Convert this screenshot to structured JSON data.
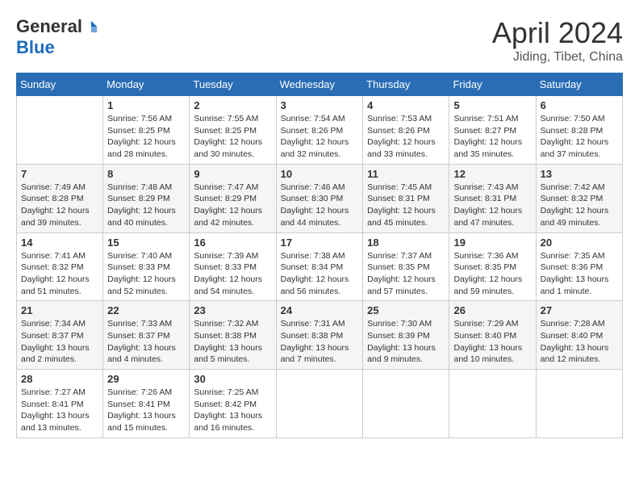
{
  "logo": {
    "general": "General",
    "blue": "Blue"
  },
  "title": "April 2024",
  "location": "Jiding, Tibet, China",
  "days_of_week": [
    "Sunday",
    "Monday",
    "Tuesday",
    "Wednesday",
    "Thursday",
    "Friday",
    "Saturday"
  ],
  "weeks": [
    [
      {
        "day": "",
        "info": ""
      },
      {
        "day": "1",
        "info": "Sunrise: 7:56 AM\nSunset: 8:25 PM\nDaylight: 12 hours and 28 minutes."
      },
      {
        "day": "2",
        "info": "Sunrise: 7:55 AM\nSunset: 8:25 PM\nDaylight: 12 hours and 30 minutes."
      },
      {
        "day": "3",
        "info": "Sunrise: 7:54 AM\nSunset: 8:26 PM\nDaylight: 12 hours and 32 minutes."
      },
      {
        "day": "4",
        "info": "Sunrise: 7:53 AM\nSunset: 8:26 PM\nDaylight: 12 hours and 33 minutes."
      },
      {
        "day": "5",
        "info": "Sunrise: 7:51 AM\nSunset: 8:27 PM\nDaylight: 12 hours and 35 minutes."
      },
      {
        "day": "6",
        "info": "Sunrise: 7:50 AM\nSunset: 8:28 PM\nDaylight: 12 hours and 37 minutes."
      }
    ],
    [
      {
        "day": "7",
        "info": "Sunrise: 7:49 AM\nSunset: 8:28 PM\nDaylight: 12 hours and 39 minutes."
      },
      {
        "day": "8",
        "info": "Sunrise: 7:48 AM\nSunset: 8:29 PM\nDaylight: 12 hours and 40 minutes."
      },
      {
        "day": "9",
        "info": "Sunrise: 7:47 AM\nSunset: 8:29 PM\nDaylight: 12 hours and 42 minutes."
      },
      {
        "day": "10",
        "info": "Sunrise: 7:46 AM\nSunset: 8:30 PM\nDaylight: 12 hours and 44 minutes."
      },
      {
        "day": "11",
        "info": "Sunrise: 7:45 AM\nSunset: 8:31 PM\nDaylight: 12 hours and 45 minutes."
      },
      {
        "day": "12",
        "info": "Sunrise: 7:43 AM\nSunset: 8:31 PM\nDaylight: 12 hours and 47 minutes."
      },
      {
        "day": "13",
        "info": "Sunrise: 7:42 AM\nSunset: 8:32 PM\nDaylight: 12 hours and 49 minutes."
      }
    ],
    [
      {
        "day": "14",
        "info": "Sunrise: 7:41 AM\nSunset: 8:32 PM\nDaylight: 12 hours and 51 minutes."
      },
      {
        "day": "15",
        "info": "Sunrise: 7:40 AM\nSunset: 8:33 PM\nDaylight: 12 hours and 52 minutes."
      },
      {
        "day": "16",
        "info": "Sunrise: 7:39 AM\nSunset: 8:33 PM\nDaylight: 12 hours and 54 minutes."
      },
      {
        "day": "17",
        "info": "Sunrise: 7:38 AM\nSunset: 8:34 PM\nDaylight: 12 hours and 56 minutes."
      },
      {
        "day": "18",
        "info": "Sunrise: 7:37 AM\nSunset: 8:35 PM\nDaylight: 12 hours and 57 minutes."
      },
      {
        "day": "19",
        "info": "Sunrise: 7:36 AM\nSunset: 8:35 PM\nDaylight: 12 hours and 59 minutes."
      },
      {
        "day": "20",
        "info": "Sunrise: 7:35 AM\nSunset: 8:36 PM\nDaylight: 13 hours and 1 minute."
      }
    ],
    [
      {
        "day": "21",
        "info": "Sunrise: 7:34 AM\nSunset: 8:37 PM\nDaylight: 13 hours and 2 minutes."
      },
      {
        "day": "22",
        "info": "Sunrise: 7:33 AM\nSunset: 8:37 PM\nDaylight: 13 hours and 4 minutes."
      },
      {
        "day": "23",
        "info": "Sunrise: 7:32 AM\nSunset: 8:38 PM\nDaylight: 13 hours and 5 minutes."
      },
      {
        "day": "24",
        "info": "Sunrise: 7:31 AM\nSunset: 8:38 PM\nDaylight: 13 hours and 7 minutes."
      },
      {
        "day": "25",
        "info": "Sunrise: 7:30 AM\nSunset: 8:39 PM\nDaylight: 13 hours and 9 minutes."
      },
      {
        "day": "26",
        "info": "Sunrise: 7:29 AM\nSunset: 8:40 PM\nDaylight: 13 hours and 10 minutes."
      },
      {
        "day": "27",
        "info": "Sunrise: 7:28 AM\nSunset: 8:40 PM\nDaylight: 13 hours and 12 minutes."
      }
    ],
    [
      {
        "day": "28",
        "info": "Sunrise: 7:27 AM\nSunset: 8:41 PM\nDaylight: 13 hours and 13 minutes."
      },
      {
        "day": "29",
        "info": "Sunrise: 7:26 AM\nSunset: 8:41 PM\nDaylight: 13 hours and 15 minutes."
      },
      {
        "day": "30",
        "info": "Sunrise: 7:25 AM\nSunset: 8:42 PM\nDaylight: 13 hours and 16 minutes."
      },
      {
        "day": "",
        "info": ""
      },
      {
        "day": "",
        "info": ""
      },
      {
        "day": "",
        "info": ""
      },
      {
        "day": "",
        "info": ""
      }
    ]
  ]
}
